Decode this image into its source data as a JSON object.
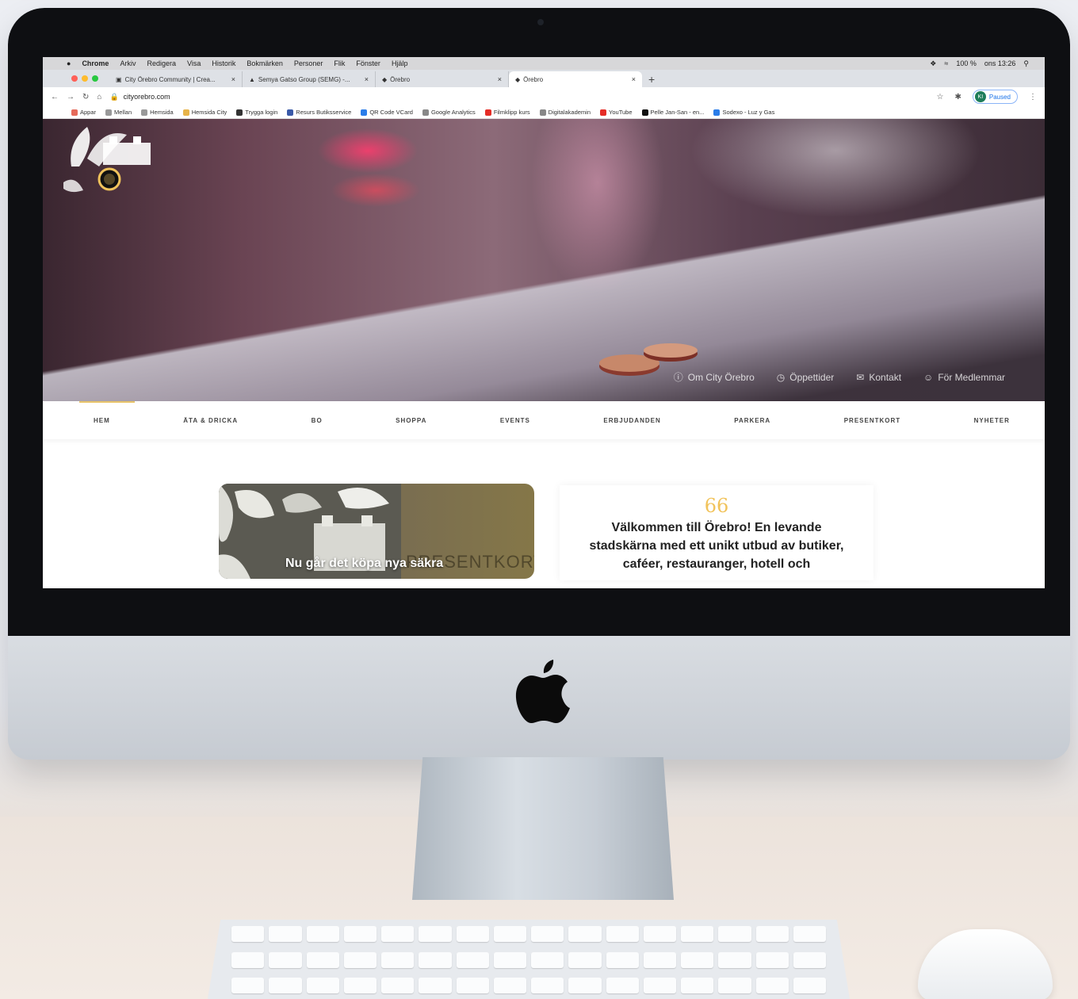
{
  "os_menu": {
    "apple": "",
    "app": "Chrome",
    "items": [
      "Arkiv",
      "Redigera",
      "Visa",
      "Historik",
      "Bokmärken",
      "Personer",
      "Flik",
      "Fönster",
      "Hjälp"
    ],
    "status": [
      "100 %",
      "ons 13:26"
    ]
  },
  "browser": {
    "tabs": [
      {
        "label": "City Örebro Community | Crea..."
      },
      {
        "label": "Semya Gatso Group (SEMG) -..."
      },
      {
        "label": "Örebro"
      },
      {
        "label": "Örebro"
      }
    ],
    "url": "cityorebro.com",
    "profile_label": "Paused",
    "profile_initials": "KI",
    "bookmarks": [
      "Appar",
      "Mellan",
      "Hemsida",
      "Hemsida City",
      "Trygga login",
      "Resurs Butiksservice",
      "QR Code VCard",
      "Google Analytics",
      "Filmklipp kurs",
      "Digitalakademin",
      "YouTube",
      "Pelle Jan-San - en...",
      "Sodexo - Luz y Gas"
    ]
  },
  "site": {
    "hero_links": [
      "Om City Örebro",
      "Öppettider",
      "Kontakt",
      "För Medlemmar"
    ],
    "nav": [
      "HEM",
      "ÄTA & DRICKA",
      "BO",
      "SHOPPA",
      "EVENTS",
      "ERBJUDANDEN",
      "PARKERA",
      "PRESENTKORT",
      "NYHETER"
    ],
    "gift_card_title": "Nu går det köpa nya säkra",
    "gift_card_word": "PRESENTKORT",
    "quote_mark": "66",
    "welcome_text": "Välkommen till Örebro! En levande stadskärna med ett unikt utbud av butiker, caféer, restauranger, hotell och"
  },
  "colors": {
    "accent": "#e8c46a",
    "quote": "#f1c35b",
    "gift_card": "#7a6e50"
  },
  "icons": {
    "hero_link_icons": [
      "info-icon",
      "clock-icon",
      "mail-icon",
      "user-icon"
    ]
  }
}
